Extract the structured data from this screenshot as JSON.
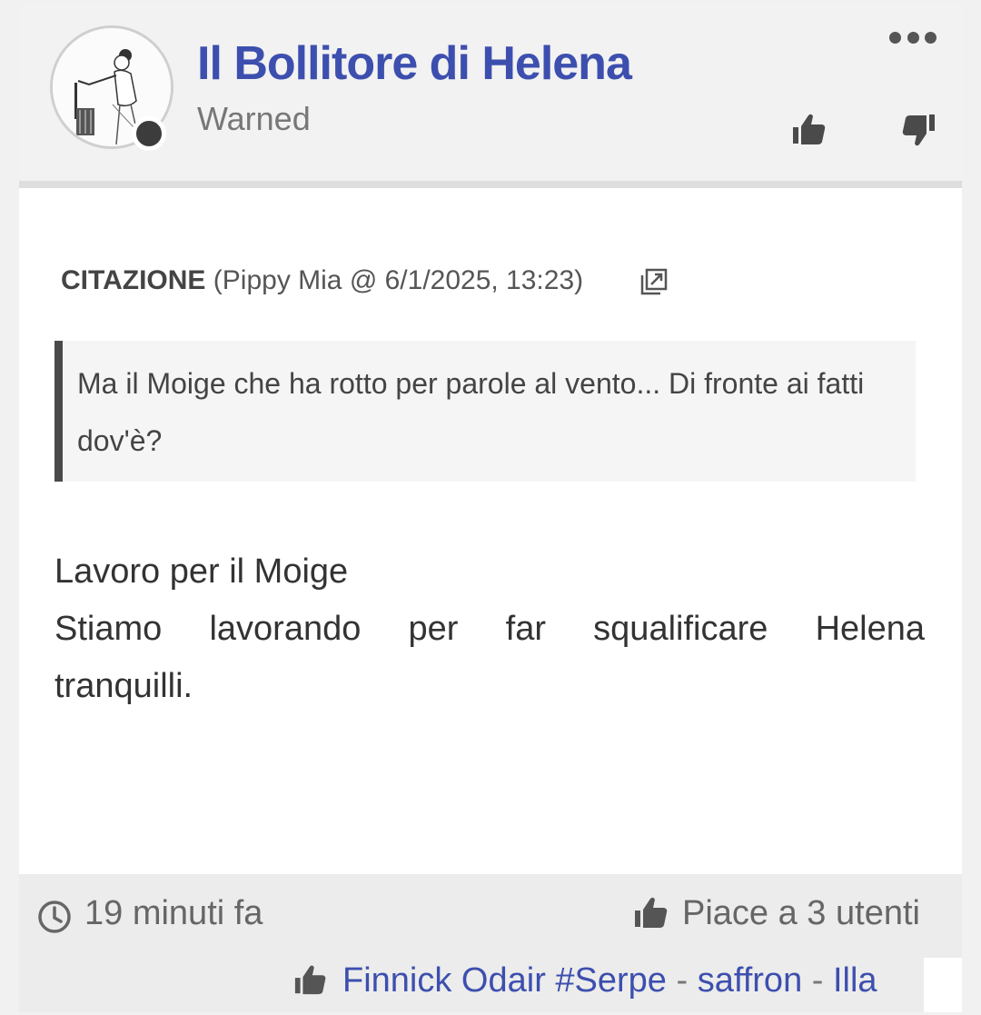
{
  "post": {
    "author": {
      "name": "Il Bollitore di Helena",
      "title": "Warned",
      "avatar_icon": "avatar-illustration",
      "status_icon": "offline-status-dot"
    },
    "actions": {
      "more_icon": "more-horizontal-icon",
      "upvote_icon": "thumbs-up-icon",
      "downvote_icon": "thumbs-down-icon"
    },
    "quote": {
      "label": "CITAZIONE",
      "meta": "(Pippy Mia @ 6/1/2025, 13:23)",
      "link_icon": "open-external-icon",
      "text": "Ma il Moige che ha rotto per parole al vento... Di fronte ai fatti dov'è?"
    },
    "body": {
      "line1": "Lavoro per il Moige",
      "line2": "Stiamo lavorando per far squalificare Helena",
      "line3": "tranquilli."
    },
    "footer": {
      "time": "19 minuti fa",
      "likes": "Piace a 3 utenti",
      "likers": [
        "Finnick Odair #Serpe",
        "saffron",
        "Illa"
      ],
      "separator": " - "
    }
  },
  "colors": {
    "accent": "#3d4fae",
    "header_bg": "#f2f2f2",
    "footer_bg": "#ececec"
  }
}
